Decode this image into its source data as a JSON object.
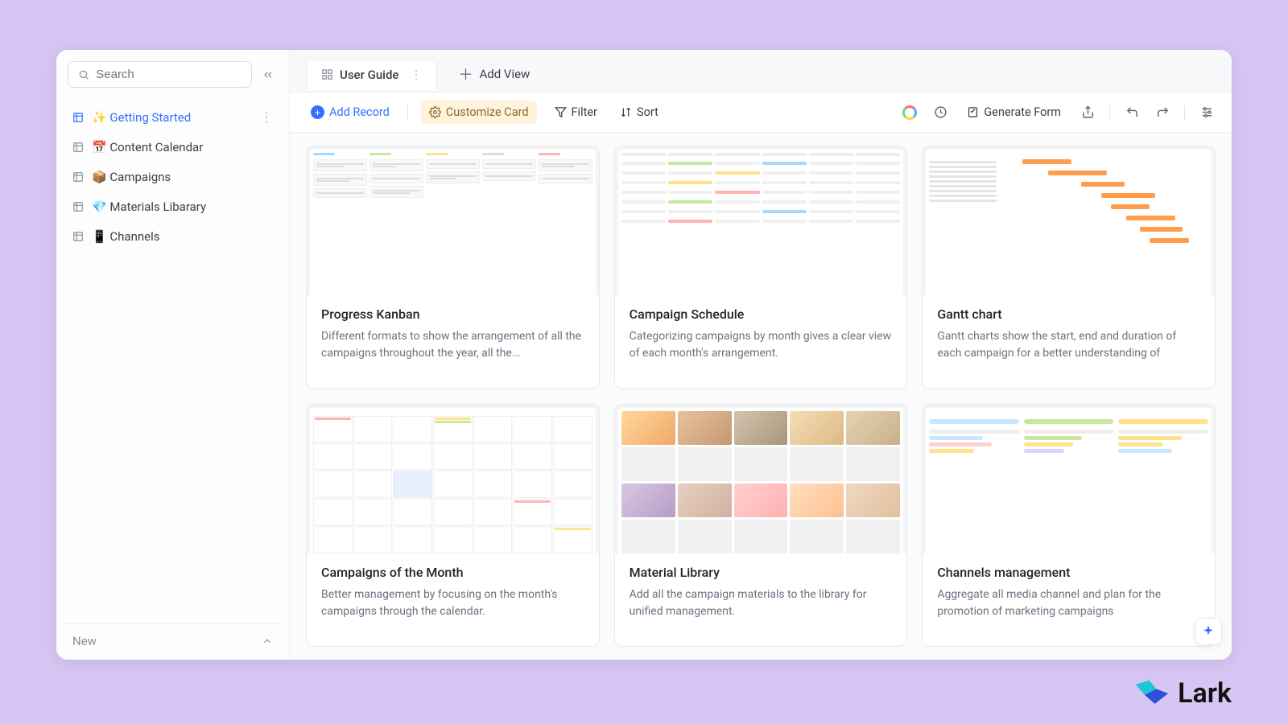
{
  "search": {
    "placeholder": "Search"
  },
  "sidebar": {
    "items": [
      {
        "label": "✨ Getting Started",
        "active": true
      },
      {
        "label": "📅 Content Calendar",
        "active": false
      },
      {
        "label": "📦 Campaigns",
        "active": false
      },
      {
        "label": "💎 Materials Libarary",
        "active": false
      },
      {
        "label": "📱 Channels",
        "active": false
      }
    ],
    "footer": "New"
  },
  "tabs": {
    "active": "User Guide",
    "add": "Add View"
  },
  "toolbar": {
    "add_record": "Add Record",
    "customize_card": "Customize Card",
    "filter": "Filter",
    "sort": "Sort",
    "generate_form": "Generate Form"
  },
  "cards": [
    {
      "title": "Progress Kanban",
      "desc": "Different formats to show the arrangement of all the campaigns throughout the year, all the..."
    },
    {
      "title": "Campaign Schedule",
      "desc": "Categorizing campaigns by month gives a clear view of each month's arrangement."
    },
    {
      "title": "Gantt chart",
      "desc": "Gantt charts show the start, end and duration of each campaign for a better understanding of"
    },
    {
      "title": "Campaigns of the Month",
      "desc": "Better management by focusing on the month's campaigns through the calendar."
    },
    {
      "title": "Material Library",
      "desc": "Add all the campaign materials to the library for unified management."
    },
    {
      "title": "Channels management",
      "desc": "Aggregate all media channel and plan for the promotion of marketing campaigns"
    }
  ],
  "brand": "Lark"
}
